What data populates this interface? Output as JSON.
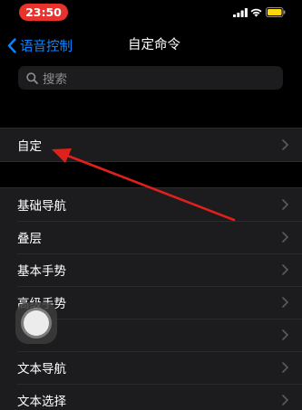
{
  "status_bar": {
    "time": "23:50",
    "time_pill_color": "#e8322c",
    "icons": [
      "signal-icon",
      "wifi-icon",
      "battery-icon"
    ],
    "battery_color": "#ffd60a"
  },
  "nav": {
    "back_label": "语音控制",
    "title": "自定命令"
  },
  "search": {
    "placeholder": "搜索"
  },
  "groups": {
    "custom": {
      "items": [
        {
          "label": "自定"
        }
      ]
    },
    "main": {
      "items": [
        {
          "label": "基础导航"
        },
        {
          "label": "叠层"
        },
        {
          "label": "基本手势"
        },
        {
          "label": "高级手势"
        },
        {
          "label": ""
        },
        {
          "label": "文本导航"
        },
        {
          "label": "文本选择"
        }
      ]
    }
  },
  "colors": {
    "accent": "#0a84ff",
    "background": "#000000",
    "cell_background": "#1c1c1e",
    "annotation_arrow": "#e0201b"
  }
}
